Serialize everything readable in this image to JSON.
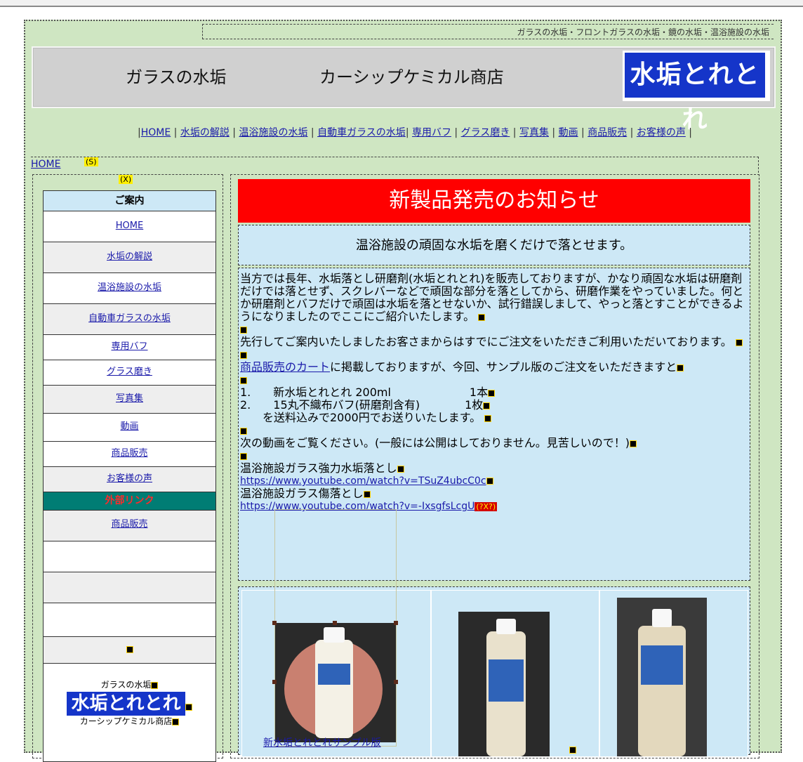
{
  "tagline": "ガラスの水垢・フロントガラスの水垢・鏡の水垢・温浴施設の水垢",
  "header": {
    "left_title": "ガラスの水垢",
    "shop_name": "カーシップケミカル商店",
    "logo_text": "水垢とれとれ"
  },
  "nav": [
    "HOME",
    "水垢の解説",
    "温浴施設の水垢",
    "自動車ガラスの水垢",
    "専用バフ",
    "グラス磨き",
    "写真集",
    "動画",
    "商品販売",
    "お客様の声"
  ],
  "breadcrumb": {
    "home": "HOME",
    "badge": "(S)"
  },
  "sidebar": {
    "badge": "(X)",
    "heading": "ご案内",
    "items": [
      "HOME",
      "水垢の解説",
      "温浴施設の水垢",
      "自動車ガラスの水垢",
      "専用バフ",
      "グラス磨き",
      "写真集",
      "動画",
      "商品販売",
      "お客様の声"
    ],
    "external_heading": "外部リンク",
    "external_items": [
      "商品販売"
    ],
    "logo_caption_top": "ガラスの水垢",
    "logo_text": "水垢とれとれ",
    "logo_caption_bottom": "カーシップケミカル商店"
  },
  "main": {
    "title": "新製品発売のお知らせ",
    "subtitle": "温浴施設の頑固な水垢を磨くだけで落とせます。",
    "para1": "当方では長年、水垢落とし研磨剤(水垢とれとれ)を販売しておりますが、かなり頑固な水垢は研磨剤だけでは落とせず、スクレバーなどで頑固な部分を落としてから、研磨作業をやっていました。何とか研磨剤とバフだけで頑固は水垢を落とせないか、試行錯誤しまして、やっと落とすことができるようになりましたのでここにご紹介いたします。",
    "para2": "先行してご案内いたしましたお客さまからはすでにご注文をいただきご利用いただいております。",
    "cart_link": "商品販売のカート",
    "para3_rest": "に掲載しておりますが、今回、サンプル版のご注文をいただきますと",
    "list1": "1.　　新水垢とれとれ  200ml　　　　　　　1本",
    "list2": "2.　　15丸不織布バフ(研磨剤含有)　　　　1枚",
    "list3": "　　を送料込みで2000円でお送りいたします。",
    "para4": "次の動画をご覧ください。(一般には公開はしておりません。見苦しいので！)",
    "video1_title": "温浴施設ガラス強力水垢落とし",
    "video1_url": "https://www.youtube.com/watch?v=TSuZ4ubcC0c",
    "video2_title": "温浴施設ガラス傷落とし",
    "video2_url": "https://www.youtube.com/watch?v=-IxsgfsLcgU",
    "video2_badge": "(?X?)",
    "gallery_caption": "新水垢とれとれサンプル版"
  }
}
